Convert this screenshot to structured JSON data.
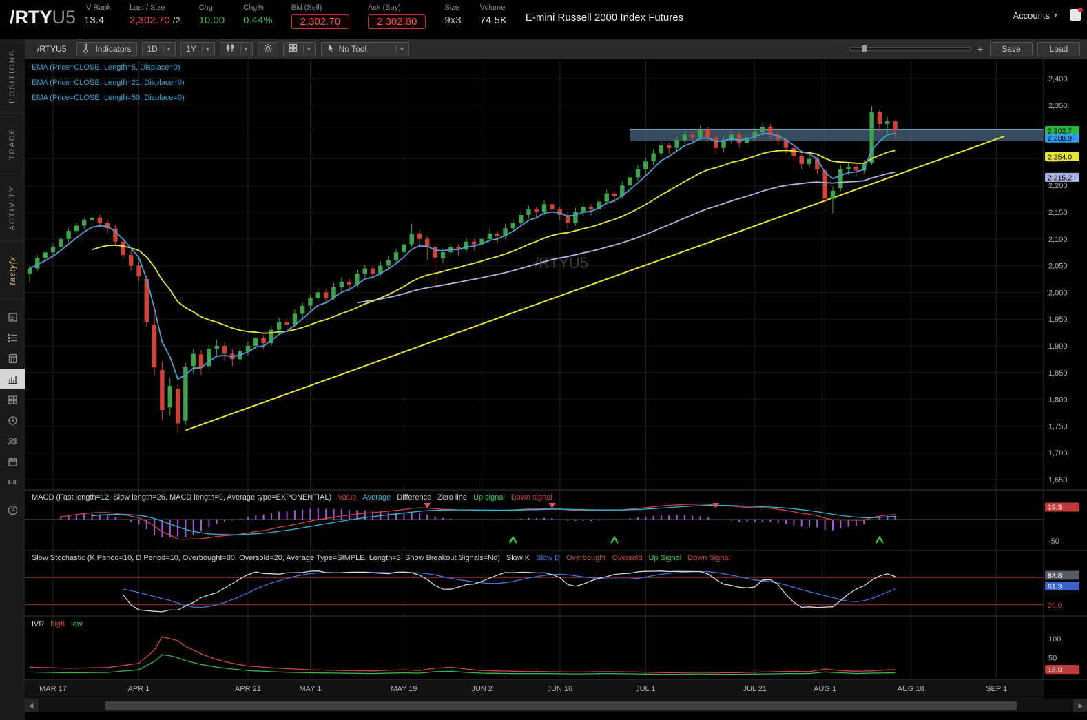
{
  "header": {
    "symbol": "/RTY",
    "symbol_suffix": "U5",
    "fields": [
      {
        "label": "IV Rank",
        "value": "13.4"
      },
      {
        "label": "Last / Size",
        "value": "2,302.70",
        "suffix": "/2"
      },
      {
        "label": "Chg",
        "value": "10.00"
      },
      {
        "label": "Chg%",
        "value": "0.44%"
      },
      {
        "label": "Bid (Sell)",
        "value": "2,302.70"
      },
      {
        "label": "Ask (Buy)",
        "value": "2,302.80"
      },
      {
        "label": "Size",
        "value": "9x3"
      },
      {
        "label": "Volume",
        "value": "74.5K"
      }
    ],
    "description": "E-mini Russell 2000 Index Futures",
    "accounts_label": "Accounts"
  },
  "sidebar": {
    "tabs": [
      {
        "label": "POSITIONS"
      },
      {
        "label": "TRADE"
      },
      {
        "label": "ACTIVITY"
      },
      {
        "label": "tastyfx"
      }
    ],
    "icons": [
      "news-icon",
      "watchlist-icon",
      "notes-icon",
      "chart-icon",
      "grid-icon",
      "history-icon",
      "people-icon",
      "calendar-icon",
      "fx-icon",
      "help-icon"
    ],
    "active_icon": "chart-icon"
  },
  "toolbar": {
    "symbol_input": "/RTYU5",
    "indicators_label": "Indicators",
    "timeframe": "1D",
    "range": "1Y",
    "tool_label": "No Tool",
    "zoom_minus": "-",
    "zoom_plus": "+",
    "save_label": "Save",
    "load_label": "Load"
  },
  "chart_data": {
    "type": "candlestick",
    "symbol": "/RTYU5",
    "watermark": "/RTYU5",
    "last_price": 2302.7,
    "legend": {
      "ema5": "EMA (Price=CLOSE, Length=5, Displace=0)",
      "ema21": "EMA (Price=CLOSE, Length=21, Displace=0)",
      "ema50": "EMA (Price=CLOSE, Length=50, Displace=0)"
    },
    "colors": {
      "candle_up": "#3fa34d",
      "candle_down": "#cf4236",
      "ema5": "#4d9fd8",
      "ema21": "#e6e63c",
      "ema50": "#aeb8e4",
      "trendline": "#e6e63c",
      "band": "rgba(108,150,185,0.5)",
      "macd_value": "#cf4545",
      "macd_average": "#35b6d9",
      "macd_hist": "#b052e0",
      "stoch_k": "#d8d8d8",
      "stoch_d": "#4a6fd4",
      "stoch_levels": "#a03030",
      "ivr_high": "#cf4545",
      "ivr_low": "#3cb54a"
    },
    "price_axis": {
      "min": 1650,
      "max": 2400,
      "step": 50,
      "labels": [
        "2,400",
        "2,350",
        "2,300",
        "2,250",
        "2,200",
        "2,150",
        "2,100",
        "2,050",
        "2,000",
        "1,950",
        "1,900",
        "1,850",
        "1,800",
        "1,750",
        "1,700",
        "1,650"
      ]
    },
    "price_badges": [
      {
        "text": "2,302.7",
        "price": 2302.7,
        "bg": "#2db83d",
        "fg": "#000"
      },
      {
        "text": "2,288.9",
        "price": 2288.9,
        "bg": "#2e9fe6",
        "fg": "#000"
      },
      {
        "text": "2,254.0",
        "price": 2254.0,
        "bg": "#e4e43c",
        "fg": "#000"
      },
      {
        "text": "2,215.2",
        "price": 2215.2,
        "bg": "#a9b4e2",
        "fg": "#000"
      }
    ],
    "time_axis": [
      {
        "label": "MAR 17",
        "i": 3
      },
      {
        "label": "APR 1",
        "i": 14
      },
      {
        "label": "APR 21",
        "i": 28
      },
      {
        "label": "MAY 1",
        "i": 36
      },
      {
        "label": "MAY 19",
        "i": 48
      },
      {
        "label": "JUN 2",
        "i": 58
      },
      {
        "label": "JUN 16",
        "i": 68
      },
      {
        "label": "JUL 1",
        "i": 79
      },
      {
        "label": "JUL 21",
        "i": 93
      },
      {
        "label": "AUG 1",
        "i": 102
      },
      {
        "label": "AUG 18",
        "i": 113
      },
      {
        "label": "SEP 1",
        "i": 124
      }
    ],
    "candles": [
      [
        2035,
        2050,
        2020,
        2045
      ],
      [
        2045,
        2070,
        2040,
        2065
      ],
      [
        2065,
        2082,
        2058,
        2075
      ],
      [
        2075,
        2092,
        2068,
        2085
      ],
      [
        2085,
        2105,
        2080,
        2100
      ],
      [
        2100,
        2120,
        2094,
        2115
      ],
      [
        2115,
        2130,
        2108,
        2125
      ],
      [
        2125,
        2140,
        2118,
        2135
      ],
      [
        2135,
        2148,
        2126,
        2140
      ],
      [
        2140,
        2146,
        2122,
        2130
      ],
      [
        2130,
        2136,
        2110,
        2120
      ],
      [
        2120,
        2126,
        2088,
        2095
      ],
      [
        2095,
        2102,
        2062,
        2070
      ],
      [
        2070,
        2080,
        2040,
        2050
      ],
      [
        2050,
        2058,
        2020,
        2030
      ],
      [
        2025,
        2032,
        1935,
        1945
      ],
      [
        1940,
        1960,
        1845,
        1860
      ],
      [
        1855,
        1870,
        1762,
        1780
      ],
      [
        1785,
        1840,
        1770,
        1825
      ],
      [
        1820,
        1828,
        1738,
        1755
      ],
      [
        1760,
        1868,
        1752,
        1860
      ],
      [
        1862,
        1895,
        1848,
        1885
      ],
      [
        1884,
        1892,
        1845,
        1860
      ],
      [
        1862,
        1902,
        1855,
        1895
      ],
      [
        1895,
        1912,
        1882,
        1900
      ],
      [
        1900,
        1906,
        1872,
        1885
      ],
      [
        1885,
        1895,
        1862,
        1875
      ],
      [
        1875,
        1898,
        1868,
        1890
      ],
      [
        1890,
        1908,
        1882,
        1900
      ],
      [
        1900,
        1922,
        1893,
        1915
      ],
      [
        1915,
        1920,
        1895,
        1905
      ],
      [
        1905,
        1938,
        1900,
        1930
      ],
      [
        1930,
        1952,
        1922,
        1945
      ],
      [
        1945,
        1950,
        1928,
        1940
      ],
      [
        1940,
        1968,
        1935,
        1960
      ],
      [
        1960,
        1982,
        1953,
        1975
      ],
      [
        1975,
        1996,
        1968,
        1990
      ],
      [
        1990,
        2008,
        1983,
        2000
      ],
      [
        2000,
        2006,
        1980,
        1990
      ],
      [
        1990,
        2018,
        1985,
        2010
      ],
      [
        2010,
        2028,
        2002,
        2020
      ],
      [
        2020,
        2026,
        2004,
        2015
      ],
      [
        2015,
        2042,
        2010,
        2035
      ],
      [
        2035,
        2052,
        2028,
        2045
      ],
      [
        2045,
        2050,
        2025,
        2035
      ],
      [
        2035,
        2058,
        2030,
        2050
      ],
      [
        2050,
        2068,
        2044,
        2060
      ],
      [
        2060,
        2082,
        2054,
        2075
      ],
      [
        2075,
        2098,
        2068,
        2090
      ],
      [
        2090,
        2128,
        2085,
        2110
      ],
      [
        2110,
        2116,
        2088,
        2100
      ],
      [
        2100,
        2106,
        2060,
        2085
      ],
      [
        2085,
        2090,
        2012,
        2065
      ],
      [
        2065,
        2082,
        2055,
        2075
      ],
      [
        2075,
        2092,
        2068,
        2085
      ],
      [
        2085,
        2090,
        2068,
        2080
      ],
      [
        2080,
        2102,
        2075,
        2095
      ],
      [
        2095,
        2100,
        2078,
        2090
      ],
      [
        2090,
        2108,
        2084,
        2100
      ],
      [
        2100,
        2118,
        2094,
        2110
      ],
      [
        2110,
        2115,
        2092,
        2105
      ],
      [
        2105,
        2128,
        2100,
        2120
      ],
      [
        2120,
        2138,
        2113,
        2130
      ],
      [
        2130,
        2152,
        2124,
        2145
      ],
      [
        2145,
        2162,
        2138,
        2155
      ],
      [
        2155,
        2160,
        2138,
        2150
      ],
      [
        2150,
        2172,
        2144,
        2165
      ],
      [
        2165,
        2170,
        2146,
        2155
      ],
      [
        2155,
        2160,
        2134,
        2145
      ],
      [
        2145,
        2150,
        2118,
        2130
      ],
      [
        2130,
        2158,
        2125,
        2150
      ],
      [
        2150,
        2168,
        2143,
        2160
      ],
      [
        2160,
        2165,
        2143,
        2155
      ],
      [
        2155,
        2178,
        2150,
        2170
      ],
      [
        2170,
        2192,
        2164,
        2185
      ],
      [
        2185,
        2190,
        2168,
        2180
      ],
      [
        2180,
        2208,
        2175,
        2200
      ],
      [
        2200,
        2222,
        2194,
        2215
      ],
      [
        2215,
        2238,
        2208,
        2230
      ],
      [
        2230,
        2252,
        2222,
        2245
      ],
      [
        2245,
        2268,
        2238,
        2260
      ],
      [
        2260,
        2282,
        2253,
        2275
      ],
      [
        2275,
        2280,
        2258,
        2270
      ],
      [
        2270,
        2292,
        2263,
        2285
      ],
      [
        2285,
        2302,
        2278,
        2295
      ],
      [
        2295,
        2300,
        2276,
        2290
      ],
      [
        2290,
        2312,
        2284,
        2305
      ],
      [
        2305,
        2310,
        2282,
        2290
      ],
      [
        2290,
        2295,
        2258,
        2270
      ],
      [
        2270,
        2292,
        2262,
        2285
      ],
      [
        2285,
        2302,
        2278,
        2295
      ],
      [
        2295,
        2300,
        2272,
        2280
      ],
      [
        2280,
        2298,
        2273,
        2290
      ],
      [
        2290,
        2308,
        2284,
        2300
      ],
      [
        2300,
        2318,
        2293,
        2310
      ],
      [
        2310,
        2315,
        2286,
        2295
      ],
      [
        2295,
        2300,
        2276,
        2285
      ],
      [
        2285,
        2290,
        2260,
        2270
      ],
      [
        2270,
        2276,
        2246,
        2255
      ],
      [
        2255,
        2260,
        2230,
        2240
      ],
      [
        2240,
        2258,
        2234,
        2250
      ],
      [
        2250,
        2254,
        2222,
        2230
      ],
      [
        2228,
        2232,
        2152,
        2175
      ],
      [
        2175,
        2198,
        2148,
        2190
      ],
      [
        2195,
        2238,
        2190,
        2230
      ],
      [
        2230,
        2242,
        2220,
        2235
      ],
      [
        2235,
        2240,
        2216,
        2228
      ],
      [
        2228,
        2248,
        2222,
        2240
      ],
      [
        2242,
        2348,
        2238,
        2338
      ],
      [
        2338,
        2342,
        2300,
        2315
      ],
      [
        2315,
        2328,
        2298,
        2320
      ],
      [
        2320,
        2322,
        2290,
        2302.7
      ]
    ],
    "overlays": {
      "ema_lengths": [
        5,
        21,
        50
      ],
      "trendline": {
        "from_i": 20,
        "from_price": 1742,
        "to_i": 125,
        "to_price": 2292
      },
      "resistance_band": {
        "from_i": 77,
        "price_top": 2305,
        "price_bottom": 2283
      }
    },
    "macd": {
      "label": "MACD (Fast length=12, Slow length=26, MACD length=9, Average type=EXPONENTIAL)",
      "items": [
        {
          "text": "Value"
        },
        {
          "text": "Average"
        },
        {
          "text": "Difference"
        },
        {
          "text": "Zero line"
        },
        {
          "text": "Up signal"
        },
        {
          "text": "Down signal"
        }
      ],
      "params": {
        "fast": 12,
        "slow": 26,
        "signal": 9
      },
      "up_signals_i": [
        62,
        75,
        109
      ],
      "down_signals_i": [
        51,
        67,
        88
      ],
      "axis_badge": {
        "text": "19.3",
        "bg": "#c23b3b",
        "fg": "#fff"
      },
      "axis_label": "-50"
    },
    "stochastic": {
      "label": "Slow Stochastic (K Period=10, D Period=10, Overbought=80, Oversold=20, Average Type=SIMPLE, Length=3, Show Breakout Signals=No)",
      "items": [
        {
          "text": "Slow K"
        },
        {
          "text": "Slow D"
        },
        {
          "text": "Overbought"
        },
        {
          "text": "Oversold"
        },
        {
          "text": "Up Signal"
        },
        {
          "text": "Down Signal"
        }
      ],
      "overbought": 80,
      "oversold": 20,
      "badges": [
        {
          "text": "84.8",
          "bg": "#565b63",
          "fg": "#fff",
          "v": 84.8
        },
        {
          "text": "61.3",
          "bg": "#3a64c8",
          "fg": "#fff",
          "v": 61.3
        },
        {
          "text": "20.0",
          "bg": "",
          "fg": "#d04545",
          "v": 20
        }
      ]
    },
    "ivr": {
      "label": "IVR",
      "items": [
        {
          "text": "high"
        },
        {
          "text": "low"
        }
      ],
      "axis_labels": [
        {
          "text": "100",
          "v": 100
        },
        {
          "text": "50",
          "v": 50
        }
      ],
      "axis_badge": {
        "text": "18.9",
        "bg": "#c23b3b",
        "fg": "#fff",
        "v": 18.9
      },
      "high_anchors": [
        [
          0,
          25
        ],
        [
          5,
          22
        ],
        [
          10,
          24
        ],
        [
          14,
          35
        ],
        [
          16,
          70
        ],
        [
          17,
          105
        ],
        [
          18,
          100
        ],
        [
          19,
          95
        ],
        [
          20,
          80
        ],
        [
          22,
          60
        ],
        [
          24,
          45
        ],
        [
          26,
          35
        ],
        [
          28,
          28
        ],
        [
          32,
          22
        ],
        [
          36,
          18
        ],
        [
          40,
          16
        ],
        [
          44,
          15
        ],
        [
          48,
          18
        ],
        [
          50,
          16
        ],
        [
          52,
          22
        ],
        [
          54,
          25
        ],
        [
          56,
          20
        ],
        [
          58,
          16
        ],
        [
          62,
          14
        ],
        [
          66,
          13
        ],
        [
          70,
          12
        ],
        [
          74,
          13
        ],
        [
          78,
          12
        ],
        [
          82,
          10
        ],
        [
          86,
          11
        ],
        [
          90,
          10
        ],
        [
          94,
          12
        ],
        [
          98,
          14
        ],
        [
          100,
          13
        ],
        [
          102,
          20
        ],
        [
          104,
          16
        ],
        [
          106,
          14
        ],
        [
          108,
          15
        ],
        [
          111,
          18.9
        ]
      ],
      "low_anchors": [
        [
          0,
          12
        ],
        [
          5,
          10
        ],
        [
          10,
          11
        ],
        [
          14,
          18
        ],
        [
          16,
          40
        ],
        [
          17,
          58
        ],
        [
          18,
          55
        ],
        [
          19,
          50
        ],
        [
          20,
          42
        ],
        [
          22,
          32
        ],
        [
          24,
          25
        ],
        [
          26,
          20
        ],
        [
          28,
          16
        ],
        [
          32,
          12
        ],
        [
          36,
          10
        ],
        [
          40,
          9
        ],
        [
          44,
          8
        ],
        [
          48,
          10
        ],
        [
          50,
          9
        ],
        [
          52,
          13
        ],
        [
          54,
          14
        ],
        [
          56,
          11
        ],
        [
          58,
          9
        ],
        [
          62,
          8
        ],
        [
          66,
          8
        ],
        [
          70,
          7
        ],
        [
          74,
          8
        ],
        [
          78,
          7
        ],
        [
          82,
          6
        ],
        [
          86,
          7
        ],
        [
          90,
          6
        ],
        [
          94,
          7
        ],
        [
          98,
          8
        ],
        [
          100,
          8
        ],
        [
          102,
          12
        ],
        [
          104,
          10
        ],
        [
          106,
          8
        ],
        [
          108,
          9
        ],
        [
          111,
          10
        ]
      ]
    }
  }
}
